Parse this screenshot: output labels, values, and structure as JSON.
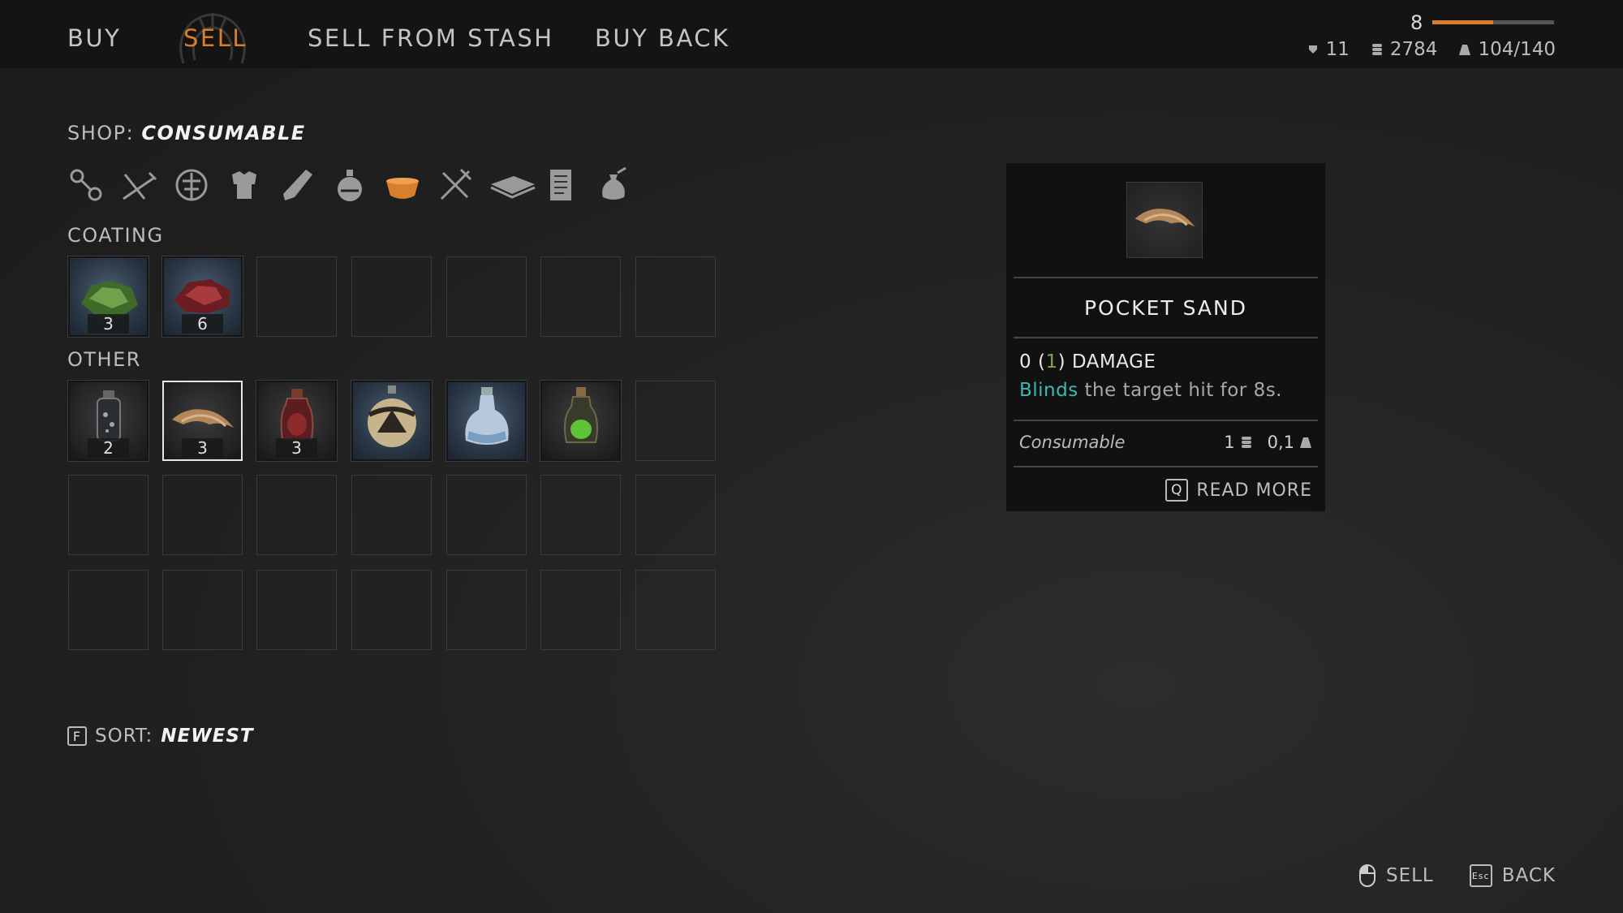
{
  "tabs": [
    {
      "label": "BUY",
      "active": false
    },
    {
      "label": "SELL",
      "active": true
    },
    {
      "label": "SELL FROM STASH",
      "active": false
    },
    {
      "label": "BUY BACK",
      "active": false
    }
  ],
  "player": {
    "level": "8",
    "xp_progress": 0.5,
    "skill_points": "11",
    "coins": "2784",
    "weight": "104/140"
  },
  "shop": {
    "label": "SHOP:",
    "category": "CONSUMABLE",
    "categories": [
      "weapon-icon",
      "crossed-swords-icon",
      "shield-icon",
      "armor-icon",
      "leg-armor-icon",
      "potion-icon",
      "food-bowl-icon",
      "tools-icon",
      "book-icon",
      "scroll-icon",
      "pouch-icon"
    ],
    "active_category": 6
  },
  "sections": {
    "coating": {
      "label": "COATING",
      "items": [
        {
          "name": "green-coating",
          "count": "3"
        },
        {
          "name": "red-coating",
          "count": "6"
        }
      ]
    },
    "other": {
      "label": "OTHER",
      "items": [
        {
          "name": "dark-vial",
          "count": "2"
        },
        {
          "name": "pocket-sand",
          "count": "3",
          "selected": true
        },
        {
          "name": "red-potion",
          "count": "3"
        },
        {
          "name": "smoke-bomb",
          "count": ""
        },
        {
          "name": "blue-flask",
          "count": ""
        },
        {
          "name": "green-flask",
          "count": ""
        }
      ]
    }
  },
  "sort": {
    "key": "F",
    "label": "SORT:",
    "value": "NEWEST"
  },
  "tooltip": {
    "name": "POCKET SAND",
    "damage_base": "0",
    "damage_bonus": "1",
    "damage_label": "DAMAGE",
    "desc_keyword": "Blinds",
    "desc_rest": "the target hit for 8s.",
    "type": "Consumable",
    "price": "1",
    "weight": "0,1",
    "read_more_key": "Q",
    "read_more_label": "READ MORE"
  },
  "actions": {
    "sell_label": "SELL",
    "back_key": "Esc",
    "back_label": "BACK"
  },
  "colors": {
    "accent": "#d97e2c",
    "keyword": "#3bbab2",
    "bonus": "#7aa64a"
  }
}
